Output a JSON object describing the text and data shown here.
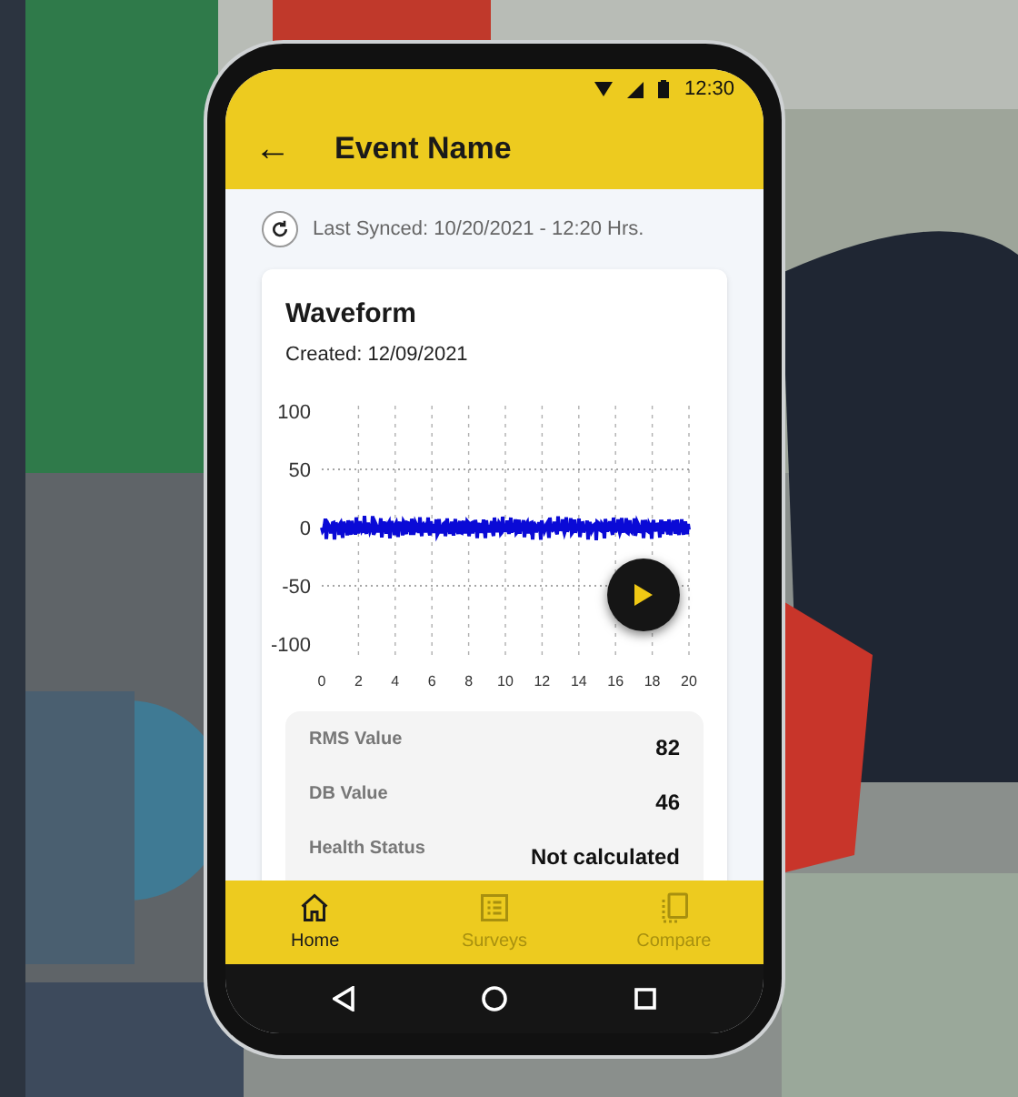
{
  "status_bar": {
    "time": "12:30"
  },
  "app_bar": {
    "back": "←",
    "title": "Event Name"
  },
  "sync": {
    "text": "Last Synced: 10/20/2021 - 12:20 Hrs."
  },
  "card": {
    "title": "Waveform",
    "created": "Created: 12/09/2021",
    "waveform": {
      "y_ticks": [
        "100",
        "50",
        "0",
        "-50",
        "-100"
      ],
      "x_ticks": [
        "0",
        "2",
        "4",
        "6",
        "8",
        "10",
        "12",
        "14",
        "16",
        "18",
        "20"
      ]
    },
    "stats": [
      {
        "label": "RMS Value",
        "value": "82"
      },
      {
        "label": "DB Value",
        "value": "46"
      },
      {
        "label": "Health Status",
        "value": "Not calculated"
      }
    ]
  },
  "bottom_nav": [
    {
      "label": "Home",
      "kind": "home",
      "selected": true
    },
    {
      "label": "Surveys",
      "kind": "list",
      "selected": false
    },
    {
      "label": "Compare",
      "kind": "compare",
      "selected": false
    }
  ]
}
